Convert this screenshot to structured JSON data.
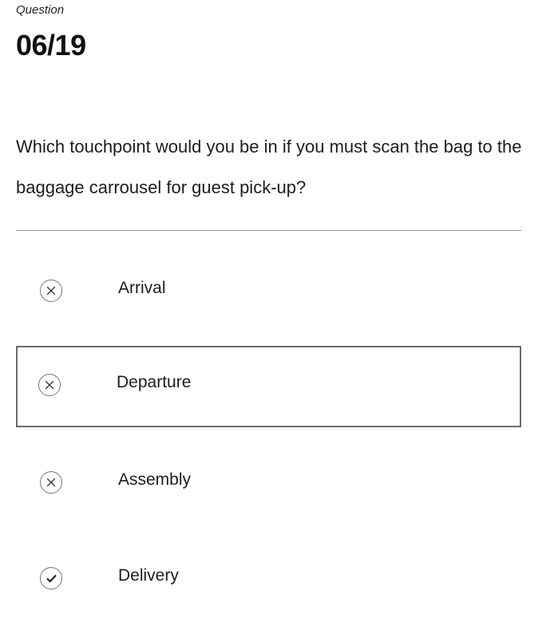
{
  "header": {
    "label": "Question",
    "counter": "06/19"
  },
  "question": {
    "text": "Which touchpoint would you be in if you must scan the bag to the baggage carrousel for guest pick-up?"
  },
  "options": [
    {
      "label": "Arrival",
      "icon": "x-circle-icon",
      "state": "incorrect"
    },
    {
      "label": "Departure",
      "icon": "x-circle-icon",
      "state": "incorrect",
      "focused": true
    },
    {
      "label": "Assembly",
      "icon": "x-circle-icon",
      "state": "incorrect"
    },
    {
      "label": "Delivery",
      "icon": "check-circle-icon",
      "state": "correct"
    }
  ],
  "colors": {
    "focus_border": "#6b6b6b",
    "divider": "#999999",
    "icon_border": "#777777",
    "text": "#1d1d1d"
  }
}
